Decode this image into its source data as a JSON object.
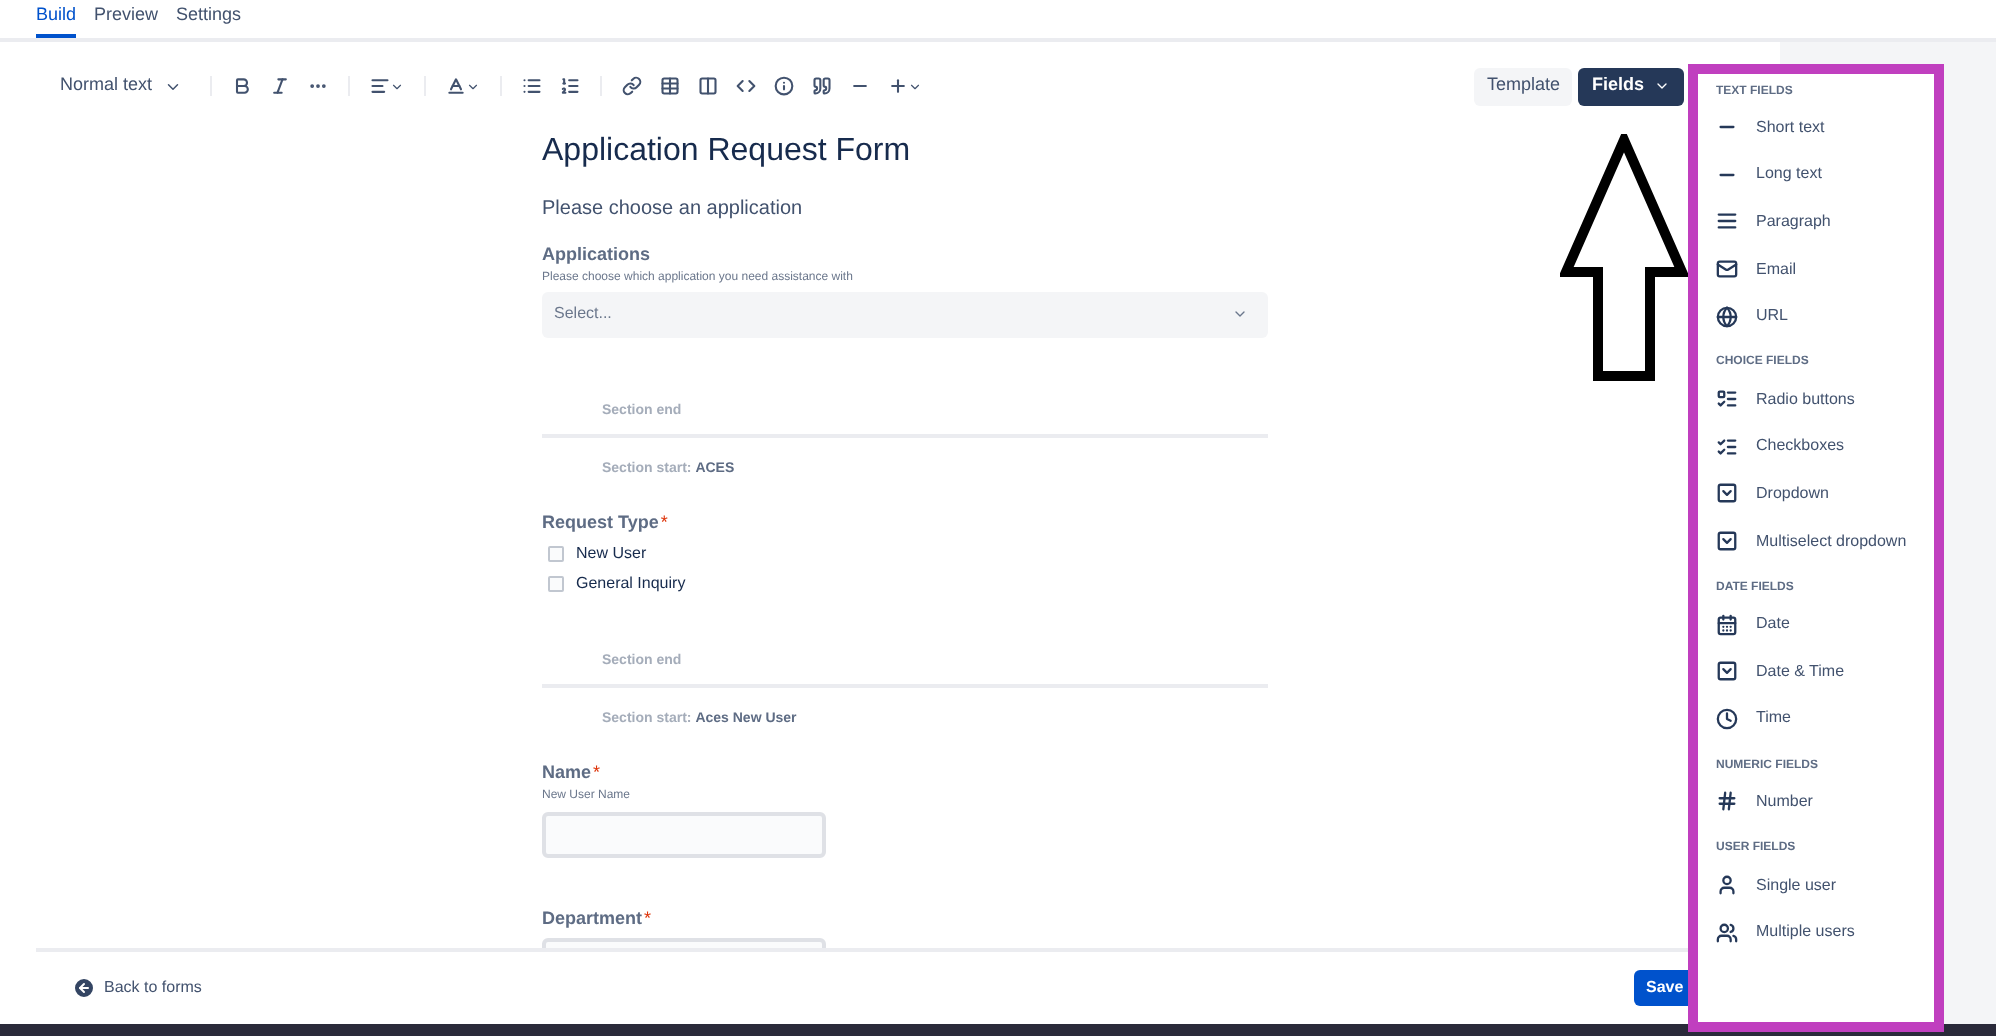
{
  "tabs": [
    {
      "label": "Build",
      "selected": true
    },
    {
      "label": "Preview",
      "selected": false
    },
    {
      "label": "Settings",
      "selected": false
    }
  ],
  "toolbar": {
    "text_style": "Normal text",
    "template_button": "Template",
    "fields_button": {
      "label": "Fields",
      "expanded": true
    }
  },
  "form": [
    {
      "kind": "heading",
      "text": "Application Request Form"
    },
    {
      "kind": "paragraph",
      "text": "Please choose an application"
    },
    {
      "kind": "select",
      "label": "Applications",
      "description": "Please choose which application you need assistance with",
      "placeholder": "Select..."
    },
    {
      "kind": "section_end",
      "text": "Section end"
    },
    {
      "kind": "section_start",
      "text": "Section start:",
      "name": "ACES"
    },
    {
      "kind": "checkboxes",
      "label": "Request Type",
      "required_mark": "*",
      "options": [
        {
          "label": "New User",
          "checked": false
        },
        {
          "label": "General Inquiry",
          "checked": false
        }
      ]
    },
    {
      "kind": "section_end",
      "text": "Section end"
    },
    {
      "kind": "section_start",
      "text": "Section start:",
      "name": "Aces New User"
    },
    {
      "kind": "text",
      "label": "Name",
      "required_mark": "*",
      "description": "New User Name"
    },
    {
      "kind": "text",
      "label": "Department",
      "required_mark": "*"
    }
  ],
  "footer": {
    "back": "Back to forms",
    "save": "Save"
  },
  "fields_menu": [
    {
      "title": "TEXT FIELDS",
      "items": [
        {
          "label": "Short text",
          "kind": "short"
        },
        {
          "label": "Long text",
          "kind": "long"
        },
        {
          "label": "Paragraph",
          "kind": "paragraph"
        },
        {
          "label": "Email",
          "kind": "email"
        },
        {
          "label": "URL",
          "kind": "url"
        }
      ]
    },
    {
      "title": "CHOICE FIELDS",
      "items": [
        {
          "label": "Radio buttons",
          "kind": "radio"
        },
        {
          "label": "Checkboxes",
          "kind": "checkbox"
        },
        {
          "label": "Dropdown",
          "kind": "dropdown"
        },
        {
          "label": "Multiselect dropdown",
          "kind": "dropdown"
        }
      ]
    },
    {
      "title": "DATE FIELDS",
      "items": [
        {
          "label": "Date",
          "kind": "date"
        },
        {
          "label": "Date & Time",
          "kind": "dropdown"
        },
        {
          "label": "Time",
          "kind": "time"
        }
      ]
    },
    {
      "title": "NUMERIC FIELDS",
      "items": [
        {
          "label": "Number",
          "kind": "number"
        }
      ]
    },
    {
      "title": "USER FIELDS",
      "items": [
        {
          "label": "Single user",
          "kind": "user"
        },
        {
          "label": "Multiple users",
          "kind": "users"
        }
      ]
    }
  ]
}
